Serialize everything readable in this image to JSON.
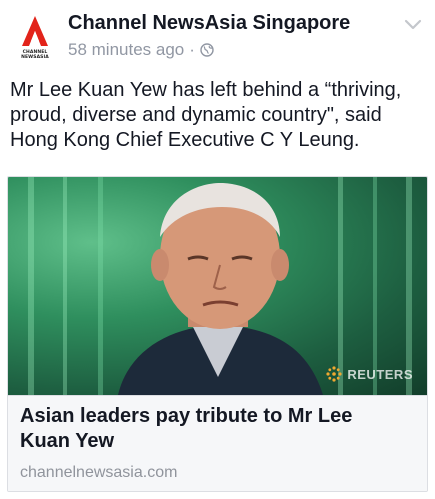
{
  "post": {
    "page_name": "Channel NewsAsia Singapore",
    "timestamp": "58 minutes ago",
    "separator": "·",
    "audience_icon": "globe-icon",
    "menu_icon": "chevron-down-icon",
    "logo_text": "CHANNEL NEWSASIA",
    "message": "Mr Lee Kuan Yew has left behind a “thriving, proud, diverse and dynamic country\", said Hong Kong Chief Executive C Y Leung."
  },
  "link_card": {
    "image_watermark": "REUTERS",
    "title": "Asian leaders pay tribute to Mr Lee Kuan Yew",
    "domain": "channelnewsasia.com"
  },
  "colors": {
    "brand_red": "#e2231a",
    "secondary_text": "#9197a3",
    "card_bg": "#f6f7f9"
  }
}
